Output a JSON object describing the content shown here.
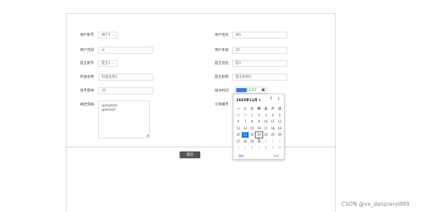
{
  "form": {
    "fields_left": [
      {
        "label": "用户账号",
        "value": "用户1",
        "kind": "select"
      },
      {
        "label": "用户性别",
        "value": "女",
        "kind": "input"
      },
      {
        "label": "医生账号",
        "value": "医生1",
        "kind": "select"
      },
      {
        "label": "科室名称",
        "value": "科室名称1",
        "kind": "input"
      },
      {
        "label": "挂号费用",
        "value": "25",
        "kind": "input"
      },
      {
        "label": "病史现病"
      }
    ],
    "fields_right": [
      {
        "label": "用户姓名",
        "value": "用1",
        "kind": "input"
      },
      {
        "label": "用户年龄",
        "value": "30",
        "kind": "input"
      },
      {
        "label": "医生姓名",
        "value": "医1",
        "kind": "input"
      },
      {
        "label": "医生职称",
        "value": "医生职称1",
        "kind": "input"
      },
      {
        "label": "就诊时间",
        "value": "11/21"
      },
      {
        "label": "订单编号"
      }
    ],
    "history_text": "dsfsdfsfd\ngdfsfsdf",
    "submit_label": "提交"
  },
  "datepicker": {
    "header": "2023年11月",
    "weekdays": [
      "一",
      "二",
      "三",
      "四",
      "五",
      "六",
      "日"
    ],
    "weeks": [
      [
        "30",
        "31",
        "1",
        "2",
        "3",
        "4",
        "5"
      ],
      [
        "6",
        "7",
        "8",
        "9",
        "10",
        "11",
        "12"
      ],
      [
        "13",
        "14",
        "15",
        "16",
        "17",
        "18",
        "19"
      ],
      [
        "20",
        "21",
        "22",
        "23",
        "24",
        "25",
        "26"
      ],
      [
        "27",
        "28",
        "29",
        "30",
        "1",
        "2",
        "3"
      ],
      [
        "4",
        "5",
        "6",
        "7",
        "8",
        "9",
        "10"
      ]
    ],
    "selected": "21",
    "today": "23",
    "clear_label": "清除",
    "today_label": "今天"
  },
  "watermark": "CSDN @vx_danpianji889",
  "colors": {
    "accent": "#1a73e8",
    "submit": "#555555"
  }
}
